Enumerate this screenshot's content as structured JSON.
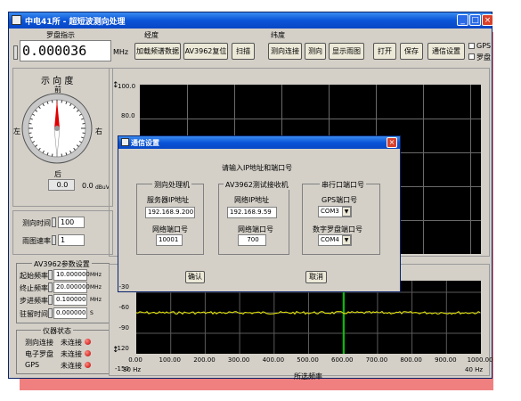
{
  "window": {
    "title": "中电41所 - 超短波测向处理",
    "controls": [
      "_",
      "□",
      "×"
    ]
  },
  "toolbar": {
    "group_labels": {
      "compass": "罗盘指示",
      "longitude": "经度",
      "latitude": "纬度"
    },
    "frequency_value": "0.000036",
    "frequency_unit": "MHz",
    "buttons": {
      "load_freq": "加载频谱数据",
      "av_reset": "AV3962复位",
      "scan": "扫描",
      "df_connect": "测向连接",
      "df": "测向",
      "show_rain": "显示雨图",
      "open": "打开",
      "save": "保存",
      "comm_settings": "通信设置"
    },
    "checkboxes": {
      "gps": "GPS",
      "compass": "罗盘"
    }
  },
  "compass_panel": {
    "title": "示 向 度",
    "north": "前",
    "south": "后",
    "west": "左",
    "east": "右",
    "value_box": "0.0",
    "value_text": "0.0",
    "value_unit": "dBuV"
  },
  "timing": {
    "df_time_label": "测向时间",
    "df_time_value": "100",
    "rain_rate_label": "雨图速率",
    "rain_rate_value": "1"
  },
  "av_settings": {
    "title": "AV3962参数设置",
    "rows": [
      {
        "label": "起始频率",
        "value": "10.000000",
        "unit": "MHz"
      },
      {
        "label": "终止频率",
        "value": "20.000000",
        "unit": "MHz"
      },
      {
        "label": "步进频率",
        "value": "0.100000",
        "unit": "MHz"
      },
      {
        "label": "驻留时间",
        "value": "0.000000",
        "unit": "S"
      }
    ]
  },
  "device_status": {
    "title": "仪器状态",
    "rows": [
      {
        "label": "测向连接",
        "status": "未连接"
      },
      {
        "label": "电子罗盘",
        "status": "未连接"
      },
      {
        "label": "GPS",
        "status": "未连接"
      }
    ]
  },
  "top_plot": {
    "y_ticks": [
      "100.0",
      "80.0"
    ]
  },
  "bottom_plot": {
    "y_ticks": [
      "-30",
      "-60",
      "-90",
      "-120",
      "-150"
    ],
    "x_ticks": [
      "0.00",
      "100.00",
      "200.00",
      "300.00",
      "400.00",
      "500.00",
      "600.00",
      "700.00",
      "800.00",
      "900.00",
      "1000.00"
    ],
    "x_start": "30 Hz",
    "x_end": "40 Hz",
    "xlabel": "所选频率",
    "colors": {
      "trace": "#e8e800",
      "marker": "#00c000"
    }
  },
  "dialog": {
    "title": "通信设置",
    "prompt": "请输入IP地址和端口号",
    "df_machine": {
      "title": "测向处理机",
      "ip_label": "服务器IP地址",
      "ip_value": "192.168.9.200",
      "port_label": "网络端口号",
      "port_value": "10001"
    },
    "av_receiver": {
      "title": "AV3962测试接收机",
      "ip_label": "网络IP地址",
      "ip_value": "192.168.9.59",
      "port_label": "网络端口号",
      "port_value": "700"
    },
    "serial": {
      "title": "串行口端口号",
      "gps_label": "GPS端口号",
      "gps_value": "COM3",
      "compass_label": "数字罗盘端口号",
      "compass_value": "COM4"
    },
    "ok_label": "确认",
    "cancel_label": "取消"
  }
}
